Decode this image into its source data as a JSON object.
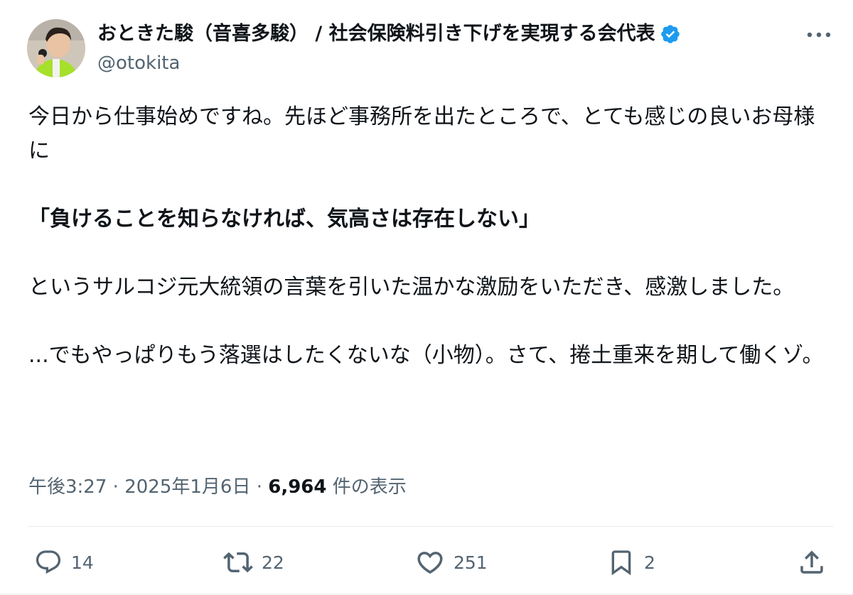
{
  "author": {
    "display_name": "おときた駿（音喜多駿） / 社会保険料引き下げを実現する会代表",
    "handle": "@otokita",
    "verified": true
  },
  "tweet": {
    "paragraph1": "今日から仕事始めですね。先ほど事務所を出たところで、とても感じの良いお母様に",
    "quote": "「負けることを知らなければ、気高さは存在しない」",
    "paragraph2": "というサルコジ元大統領の言葉を引いた温かな激励をいただき、感激しました。",
    "paragraph3": "...でもやっぱりもう落選はしたくないな（小物）。さて、捲土重来を期して働くゾ。"
  },
  "meta": {
    "time": "午後3:27",
    "separator1": " · ",
    "date": "2025年1月6日",
    "separator2": " · ",
    "views_count": "6,964",
    "views_label": " 件の表示"
  },
  "actions": {
    "reply_count": "14",
    "retweet_count": "22",
    "like_count": "251",
    "bookmark_count": "2"
  },
  "colors": {
    "text": "#0f1419",
    "secondary": "#536471",
    "verified_blue": "#1d9bf0",
    "divider": "#e6e9eb"
  },
  "icons": {
    "more": "more-dots-icon",
    "reply": "reply-bubble-icon",
    "retweet": "retweet-arrows-icon",
    "like": "heart-icon",
    "bookmark": "bookmark-icon",
    "share": "share-upload-icon",
    "verified": "verified-badge-icon"
  }
}
